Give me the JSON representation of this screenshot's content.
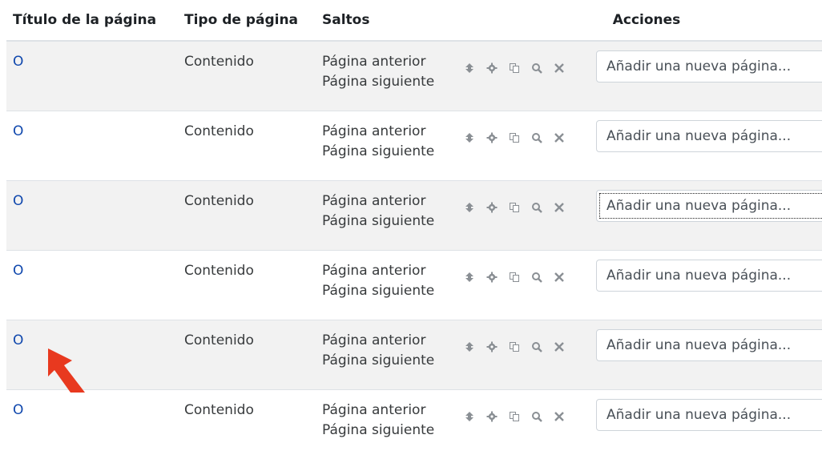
{
  "headers": {
    "title": "Título de la página",
    "type": "Tipo de página",
    "jumps": "Saltos",
    "actions": "Acciones"
  },
  "rows": [
    {
      "title": "O",
      "type": "Contenido",
      "jump1": "Página anterior",
      "jump2": "Página siguiente",
      "select": "Añadir una nueva página..."
    },
    {
      "title": "O",
      "type": "Contenido",
      "jump1": "Página anterior",
      "jump2": "Página siguiente",
      "select": "Añadir una nueva página..."
    },
    {
      "title": "O",
      "type": "Contenido",
      "jump1": "Página anterior",
      "jump2": "Página siguiente",
      "select": "Añadir una nueva página..."
    },
    {
      "title": "O",
      "type": "Contenido",
      "jump1": "Página anterior",
      "jump2": "Página siguiente",
      "select": "Añadir una nueva página..."
    },
    {
      "title": "O",
      "type": "Contenido",
      "jump1": "Página anterior",
      "jump2": "Página siguiente",
      "select": "Añadir una nueva página..."
    },
    {
      "title": "O",
      "type": "Contenido",
      "jump1": "Página anterior",
      "jump2": "Página siguiente",
      "select": "Añadir una nueva página..."
    }
  ],
  "icons": [
    "move-icon",
    "gear-icon",
    "copy-icon",
    "search-icon",
    "close-icon"
  ],
  "colors": {
    "link": "#0f47ad",
    "stripe": "#f2f2f2",
    "icon": "#8a8f94",
    "pointer": "#e8391f"
  }
}
